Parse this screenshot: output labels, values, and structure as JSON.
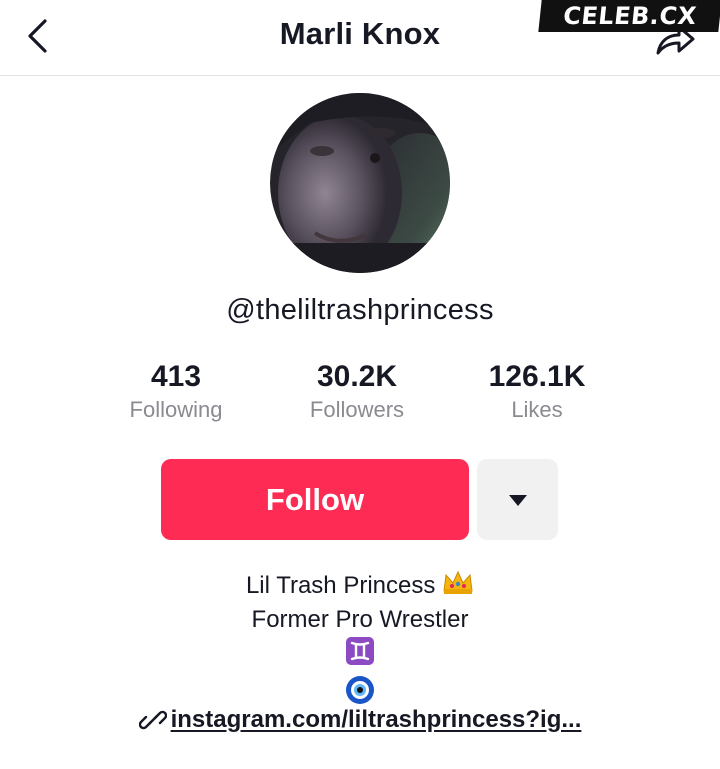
{
  "header": {
    "title": "Marli Knox",
    "back_icon": "chevron-left-icon",
    "share_icon": "share-arrow-icon"
  },
  "watermark": "CELEB.CX",
  "profile": {
    "username": "@theliltrashprincess"
  },
  "stats": [
    {
      "value": "413",
      "label": "Following"
    },
    {
      "value": "30.2K",
      "label": "Followers"
    },
    {
      "value": "126.1K",
      "label": "Likes"
    }
  ],
  "actions": {
    "follow_label": "Follow",
    "more_icon": "caret-down-icon"
  },
  "bio": {
    "line1": "Lil Trash Princess",
    "line1_emoji": "crown-emoji",
    "line2": "Former Pro Wrestler",
    "line3_emoji": "gemini-emoji",
    "line4_emoji": "nazar-amulet-emoji"
  },
  "link": {
    "icon": "link-icon",
    "text": "instagram.com/liltrashprincess?ig..."
  },
  "colors": {
    "accent": "#fe2c55",
    "secondary_button": "#f1f1f2",
    "muted_text": "#8a8b91",
    "text": "#161823"
  }
}
